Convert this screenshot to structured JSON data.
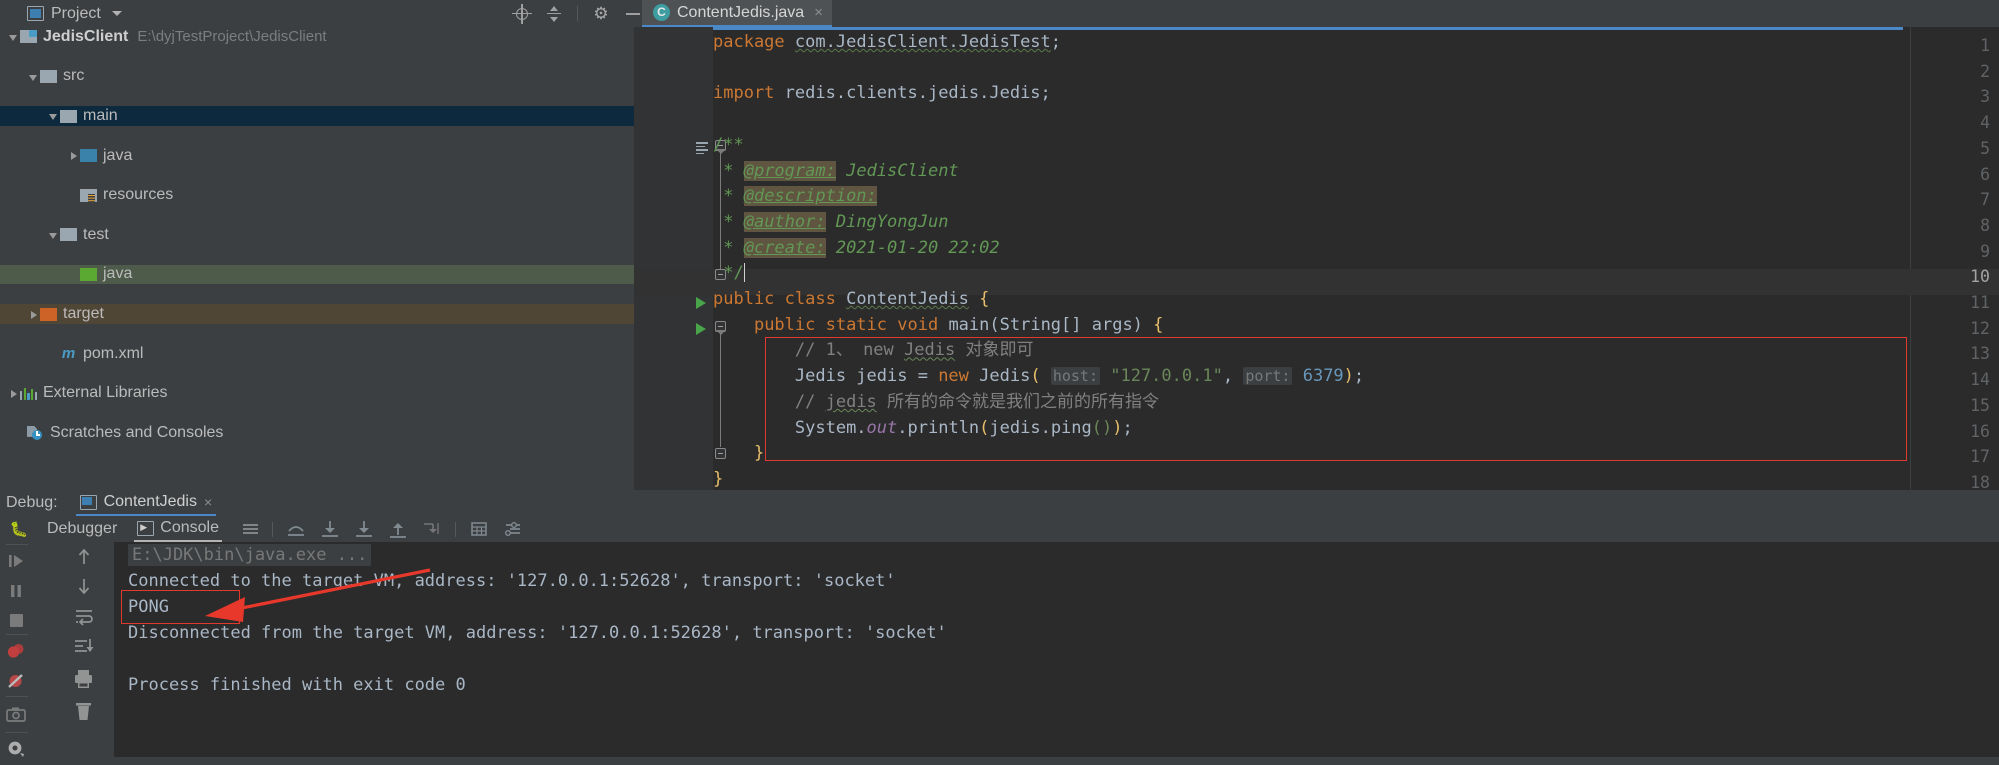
{
  "window": {
    "project_panel_title": "Project",
    "toolbar_icons": [
      "locate-icon",
      "collapse-all-icon",
      "settings-gear-icon",
      "hide-icon"
    ]
  },
  "editor_tabs": [
    {
      "label": "ContentJedis.java",
      "icon": "java-class-icon",
      "active": true,
      "close": "×"
    }
  ],
  "project_tree": [
    {
      "label": "JedisClient",
      "path": "E:\\dyjTestProject\\JedisClient",
      "icon": "module-folder-icon",
      "indent": 0,
      "arrow": "down",
      "state": "normal"
    },
    {
      "label": "src",
      "icon": "folder-gray-icon",
      "indent": 1,
      "arrow": "down",
      "state": "normal"
    },
    {
      "label": "main",
      "icon": "folder-gray-icon",
      "indent": 2,
      "arrow": "down",
      "state": "selected-blue"
    },
    {
      "label": "java",
      "icon": "folder-source-blue-icon",
      "indent": 3,
      "arrow": "right",
      "state": "normal"
    },
    {
      "label": "resources",
      "icon": "folder-resources-icon",
      "indent": 3,
      "arrow": "none",
      "state": "normal"
    },
    {
      "label": "test",
      "icon": "folder-gray-icon",
      "indent": 2,
      "arrow": "down",
      "state": "normal"
    },
    {
      "label": "java",
      "icon": "folder-test-green-icon",
      "indent": 3,
      "arrow": "none",
      "state": "highlight-green"
    },
    {
      "label": "target",
      "icon": "folder-excluded-orange-icon",
      "indent": 1,
      "arrow": "right",
      "state": "highlight-brown"
    },
    {
      "label": "pom.xml",
      "icon": "maven-m-icon",
      "indent": 2,
      "arrow": "none",
      "state": "normal"
    },
    {
      "label": "External Libraries",
      "icon": "libraries-icon",
      "indent": 0,
      "arrow": "right",
      "state": "normal"
    },
    {
      "label": "Scratches and Consoles",
      "icon": "scratches-icon",
      "indent": 0,
      "arrow": "none",
      "state": "normal"
    }
  ],
  "code": {
    "current_line": 10,
    "lines": [
      {
        "n": 1,
        "text": "package com.JedisClient.JedisTest;"
      },
      {
        "n": 2,
        "text": ""
      },
      {
        "n": 3,
        "text": "import redis.clients.jedis.Jedis;"
      },
      {
        "n": 4,
        "text": ""
      },
      {
        "n": 5,
        "text": "/**"
      },
      {
        "n": 6,
        "text": " * @program: JedisClient"
      },
      {
        "n": 7,
        "text": " * @description:"
      },
      {
        "n": 8,
        "text": " * @author: DingYongJun"
      },
      {
        "n": 9,
        "text": " * @create: 2021-01-20 22:02"
      },
      {
        "n": 10,
        "text": " */"
      },
      {
        "n": 11,
        "text": "public class ContentJedis {"
      },
      {
        "n": 12,
        "text": "    public static void main(String[] args) {"
      },
      {
        "n": 13,
        "text": "        // 1、 new Jedis 对象即可"
      },
      {
        "n": 14,
        "text": "        Jedis jedis = new Jedis( host: \"127.0.0.1\", port: 6379);"
      },
      {
        "n": 15,
        "text": "        // jedis 所有的命令就是我们之前的所有指令"
      },
      {
        "n": 16,
        "text": "        System.out.println(jedis.ping());"
      },
      {
        "n": 17,
        "text": "    }"
      },
      {
        "n": 18,
        "text": "}"
      }
    ],
    "param_hints": [
      "host:",
      "port:"
    ],
    "javadoc_tags": [
      "@program:",
      "@description:",
      "@author:",
      "@create:"
    ],
    "javadoc_values": [
      "JedisClient",
      "",
      "DingYongJun",
      "2021-01-20 22:02"
    ]
  },
  "debug": {
    "label": "Debug:",
    "session_tab": "ContentJedis",
    "session_close": "×",
    "tabs": [
      {
        "label": "Debugger",
        "active": false
      },
      {
        "label": "Console",
        "active": true
      }
    ],
    "toolbar_icons": [
      "menu-icon",
      "step-out-icon",
      "step-over-icon",
      "step-into-icon",
      "force-step-into-icon",
      "run-to-cursor-icon",
      "evaluate-icon",
      "settings-list-icon"
    ],
    "left_icons_col1": [
      "resume-program-icon",
      "pause-program-icon",
      "stop-icon",
      "view-breakpoints-icon",
      "mute-breakpoints-icon",
      "camera-icon",
      "settings-gear-icon"
    ],
    "left_icons_col2": [
      "scroll-up-icon",
      "scroll-down-icon",
      "soft-wrap-icon",
      "scroll-to-end-icon",
      "print-icon",
      "clear-all-icon"
    ]
  },
  "console": {
    "lines": [
      {
        "text": "E:\\JDK\\bin\\java.exe ...",
        "style": "dim-highlight"
      },
      {
        "text": "Connected to the target VM, address: '127.0.0.1:52628', transport: 'socket'",
        "style": "normal"
      },
      {
        "text": "PONG",
        "style": "boxed"
      },
      {
        "text": "Disconnected from the target VM, address: '127.0.0.1:52628', transport: 'socket'",
        "style": "normal"
      },
      {
        "text": "",
        "style": "normal"
      },
      {
        "text": "Process finished with exit code 0",
        "style": "normal"
      }
    ]
  },
  "annotations": {
    "arrow_color": "#e8382b",
    "box_color": "#e03a2f",
    "code_box_label": "code-highlight-box",
    "console_box_label": "pong-highlight-box"
  },
  "colors": {
    "bg_chrome": "#3c3f41",
    "bg_editor": "#2b2b2b",
    "accent_tab": "#4a88c7",
    "selection_blue": "#0d293e",
    "keyword": "#cc7832",
    "string": "#6a8759",
    "number": "#6897bb",
    "comment": "#808080",
    "javadoc": "#629755",
    "text": "#a9b7c6"
  }
}
